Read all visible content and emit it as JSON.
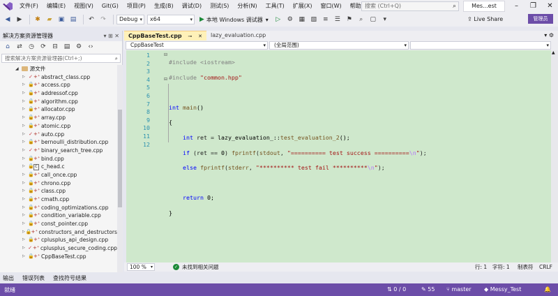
{
  "menu": {
    "items": [
      "文件(F)",
      "编辑(E)",
      "视图(V)",
      "Git(G)",
      "项目(P)",
      "生成(B)",
      "调试(D)",
      "测试(S)",
      "分析(N)",
      "工具(T)",
      "扩展(X)",
      "窗口(W)",
      "帮助(H)"
    ],
    "search_placeholder": "搜索 (Ctrl+Q)",
    "solution_name": "Mes...est"
  },
  "toolbar": {
    "config": "Debug",
    "platform": "x64",
    "run_label": "本地 Windows 调试器",
    "live_share": "Live Share",
    "admin_badge": "管理员"
  },
  "solution_explorer": {
    "title": "解决方案资源管理器",
    "search_placeholder": "搜索解决方案资源管理器(Ctrl+;)",
    "folder": "源文件",
    "files": [
      {
        "name": "abstract_class.cpp",
        "state": "check"
      },
      {
        "name": "access.cpp",
        "state": "lock"
      },
      {
        "name": "addressof.cpp",
        "state": "lock"
      },
      {
        "name": "algorithm.cpp",
        "state": "lock"
      },
      {
        "name": "allocator.cpp",
        "state": "lock"
      },
      {
        "name": "array.cpp",
        "state": "lock"
      },
      {
        "name": "atomic.cpp",
        "state": "lock"
      },
      {
        "name": "auto.cpp",
        "state": "check"
      },
      {
        "name": "bernoulli_distribution.cpp",
        "state": "lock"
      },
      {
        "name": "binary_search_tree.cpp",
        "state": "check"
      },
      {
        "name": "bind.cpp",
        "state": "lock"
      },
      {
        "name": "c_head.c",
        "state": "c"
      },
      {
        "name": "call_once.cpp",
        "state": "lock"
      },
      {
        "name": "chrono.cpp",
        "state": "lock"
      },
      {
        "name": "class.cpp",
        "state": "lock"
      },
      {
        "name": "cmath.cpp",
        "state": "lock"
      },
      {
        "name": "coding_optimizations.cpp",
        "state": "lock"
      },
      {
        "name": "condition_variable.cpp",
        "state": "lock"
      },
      {
        "name": "const_pointer.cpp",
        "state": "lock"
      },
      {
        "name": "constructors_and_destructors",
        "state": "lock"
      },
      {
        "name": "cplusplus_api_design.cpp",
        "state": "lock"
      },
      {
        "name": "cplusplus_secure_coding.cpp",
        "state": "check"
      },
      {
        "name": "CppBaseTest.cpp",
        "state": "lock"
      }
    ]
  },
  "editor": {
    "active_tab": "CppBaseTest.cpp",
    "inactive_tab": "lazy_evaluation.cpp",
    "nav_scope": "CppBaseTest",
    "nav_global": "(全局范围)",
    "line_numbers": [
      "1",
      "2",
      "3",
      "4",
      "5",
      "6",
      "7",
      "8",
      "9",
      "10",
      "11",
      "12"
    ],
    "zoom": "100 %",
    "issues": "未找到相关问题",
    "line": "行: 1",
    "col": "字符: 1",
    "tab_mode": "制表符",
    "eol": "CRLF"
  },
  "bottom_tabs": [
    "输出",
    "错误列表",
    "查找符号结果"
  ],
  "status_bar": {
    "ready": "就绪",
    "sync": "0 / 0",
    "pencil_count": "55",
    "branch": "master",
    "repo": "Messy_Test"
  },
  "colors": {
    "accent": "#6c4da8",
    "editor_bg": "#cfe8cc"
  }
}
